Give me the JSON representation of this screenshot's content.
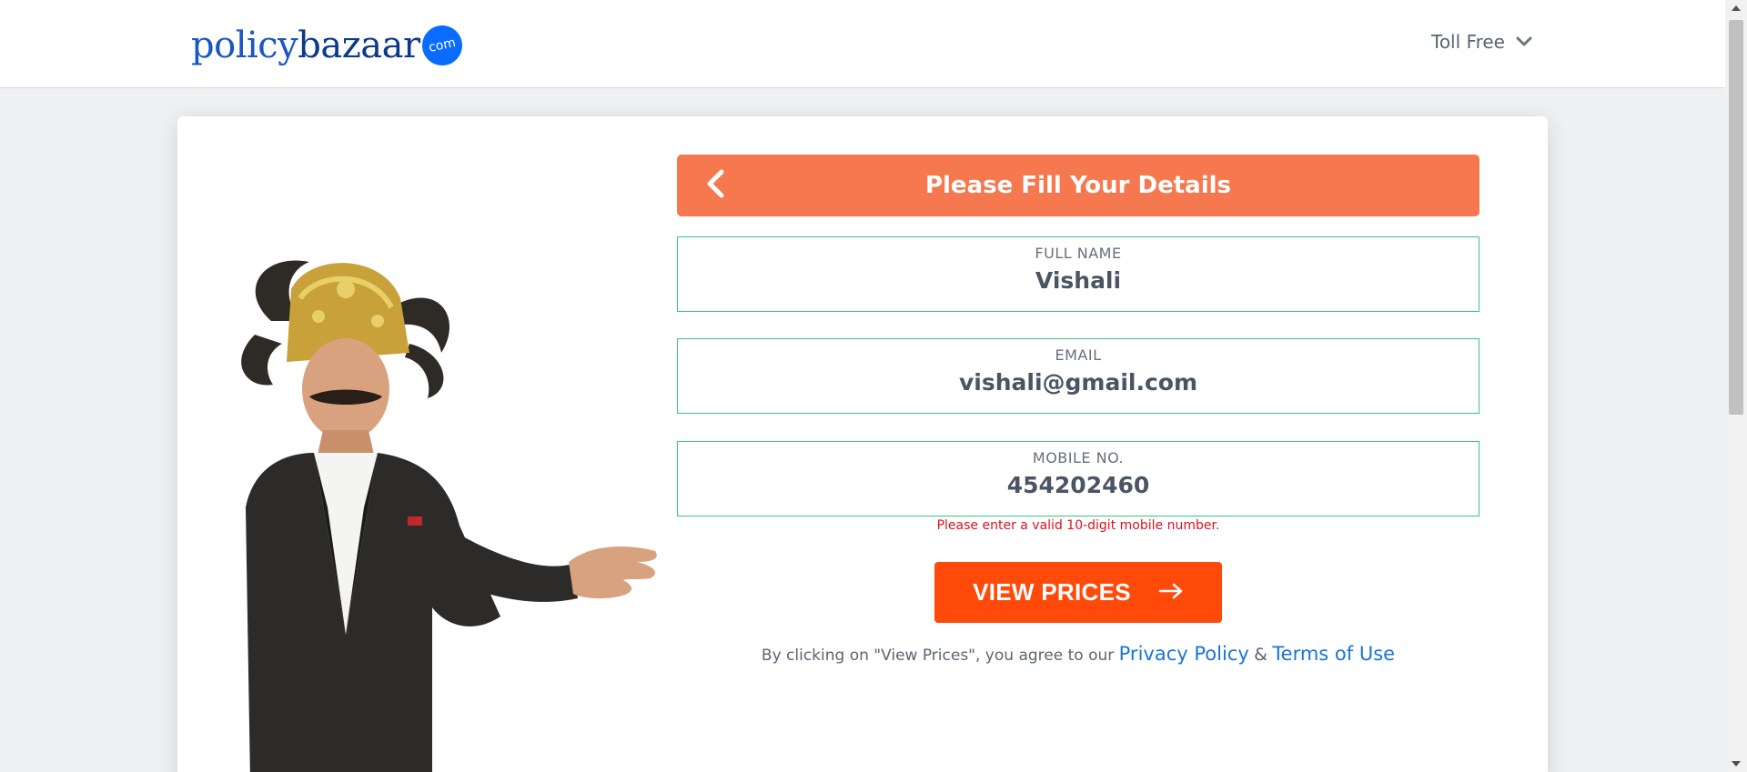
{
  "header": {
    "logo_part1": "policy",
    "logo_part2": "bazaar",
    "logo_badge": "com",
    "toll_free_label": "Toll Free"
  },
  "form": {
    "title": "Please Fill Your Details",
    "fields": [
      {
        "label": "FULL NAME",
        "value": "Vishali"
      },
      {
        "label": "EMAIL",
        "value": "vishali@gmail.com"
      },
      {
        "label": "MOBILE NO.",
        "value": "454202460"
      }
    ],
    "error_message": "Please enter a valid 10-digit mobile number.",
    "submit_label": "VIEW PRICES",
    "consent_prefix": "By clicking on \"View Prices\", you agree to our",
    "privacy_link": "Privacy Policy",
    "consent_amp": "&",
    "terms_link": "Terms of Use"
  },
  "colors": {
    "header_bar": "#f5784f",
    "submit_button": "#ff4a0a",
    "field_border": "#37c77f",
    "error": "#e0101e",
    "link": "#1a73d9"
  },
  "icons": {
    "back": "chevron-left-icon",
    "dropdown": "chevron-down-icon",
    "submit_arrow": "arrow-right-icon"
  }
}
